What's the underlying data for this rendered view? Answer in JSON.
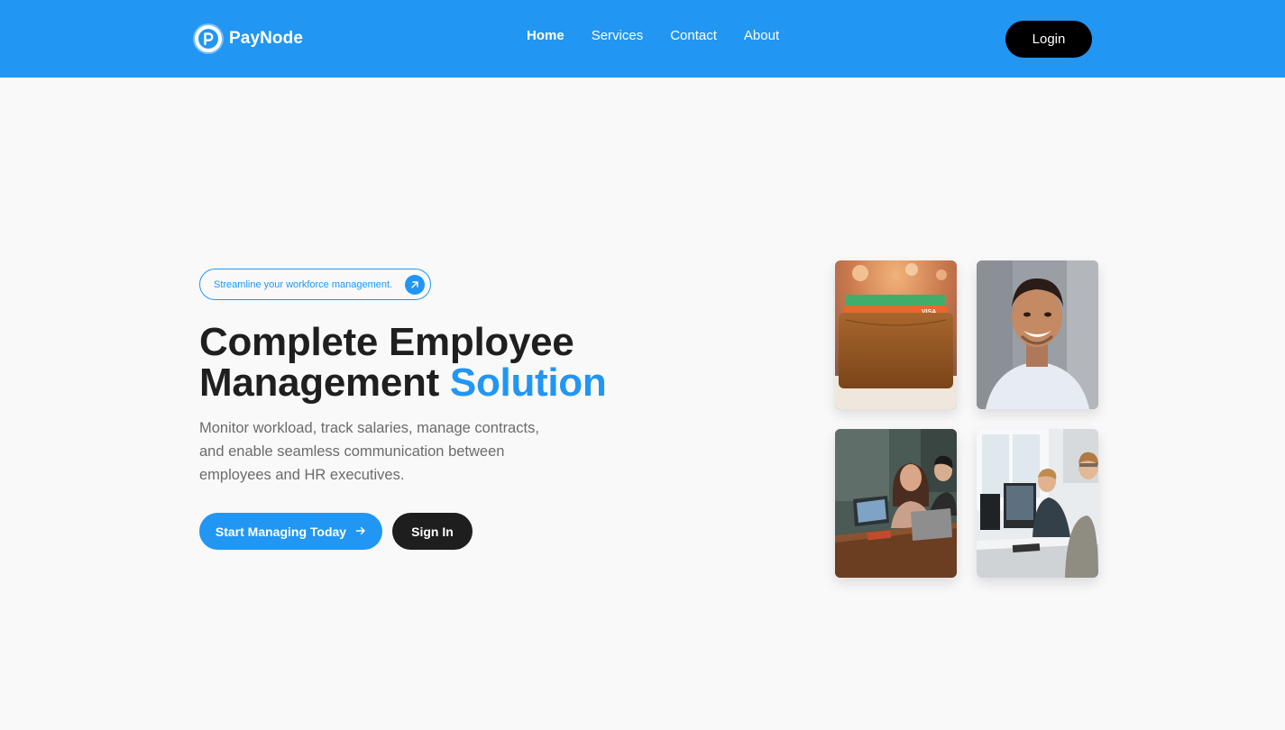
{
  "header": {
    "brand_name": "PayNode",
    "brand_icon": "paynode-logo-icon",
    "nav": [
      {
        "label": "Home",
        "active": true
      },
      {
        "label": "Services",
        "active": false
      },
      {
        "label": "Contact",
        "active": false
      },
      {
        "label": "About",
        "active": false
      }
    ],
    "login_label": "Login"
  },
  "hero": {
    "tagline": "Streamline your workforce management.",
    "tagline_icon": "arrow-up-right-icon",
    "title_line1": "Complete Employee",
    "title_line2_part1": "Management",
    "title_line2_accent": "Solution",
    "description": "Monitor workload, track salaries, manage contracts, and enable seamless communication between employees and HR executives.",
    "primary_cta": "Start Managing Today",
    "primary_cta_icon": "arrow-right-icon",
    "secondary_cta": "Sign In"
  },
  "gallery": {
    "images": [
      {
        "name": "wallet-with-cards-photo"
      },
      {
        "name": "smiling-man-portrait-photo"
      },
      {
        "name": "team-meeting-laptops-photo"
      },
      {
        "name": "office-workers-computers-photo"
      }
    ]
  },
  "colors": {
    "brand_blue": "#2196f3",
    "header_bg": "#2196f3",
    "page_bg": "#f9f9fa",
    "title_text": "#1f1f1f",
    "body_text": "#6b6b6b",
    "dark_button": "#1e1e1e",
    "login_button": "#000000"
  }
}
